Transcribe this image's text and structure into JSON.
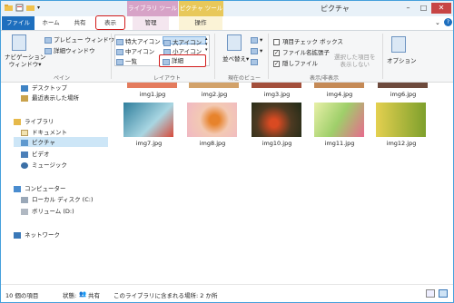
{
  "window": {
    "title": "ピクチャ"
  },
  "context_tabs": {
    "library_tools": "ライブラリ ツール",
    "picture_tools": "ピクチャ ツール"
  },
  "tabs": [
    "ファイル",
    "ホーム",
    "共有",
    "表示",
    "管理",
    "操作"
  ],
  "ribbon": {
    "pane": {
      "navigation": "ナビゲーション\nウィンドウ▾",
      "preview": "プレビュー ウィンドウ",
      "details": "詳細ウィンドウ",
      "group": "ペイン"
    },
    "layout": {
      "xlarge": "特大アイコン",
      "large": "大アイコン",
      "medium": "中アイコン",
      "small": "小アイコン",
      "list": "一覧",
      "details": "詳細",
      "group": "レイアウト"
    },
    "current_view": {
      "sort": "並べ替え",
      "group": "現在のビュー"
    },
    "show_hide": {
      "item_checkbox": "項目チェック ボックス",
      "file_ext": "ファイル名拡張子",
      "hidden": "隠しファイル",
      "hide_selected": "選択した項目を\n表示しない",
      "group": "表示/非表示"
    },
    "options": "オプション"
  },
  "nav": {
    "desktop": "デスクトップ",
    "recent": "最近表示した場所",
    "libraries": "ライブラリ",
    "documents": "ドキュメント",
    "pictures": "ピクチャ",
    "videos": "ビデオ",
    "music": "ミュージック",
    "computer": "コンピューター",
    "local_disk": "ローカル ディスク (C:)",
    "volume": "ボリューム (D:)",
    "network": "ネットワーク"
  },
  "files_row1": [
    "img1.jpg",
    "img2.jpg",
    "img3.jpg",
    "img4.jpg",
    "img6.jpg"
  ],
  "files_row2": [
    "img7.jpg",
    "img8.jpg",
    "img10.jpg",
    "img11.jpg",
    "img12.jpg"
  ],
  "status": {
    "count": "10 個の項目",
    "state_label": "状態:",
    "state_value": "共有",
    "location": "このライブラリに含まれる場所: 2 か所"
  },
  "colors": {
    "accent": "#1e6fbe",
    "highlight": "#d21b1b",
    "context_library": "#d7a3c7",
    "context_picture": "#e8c85a"
  }
}
